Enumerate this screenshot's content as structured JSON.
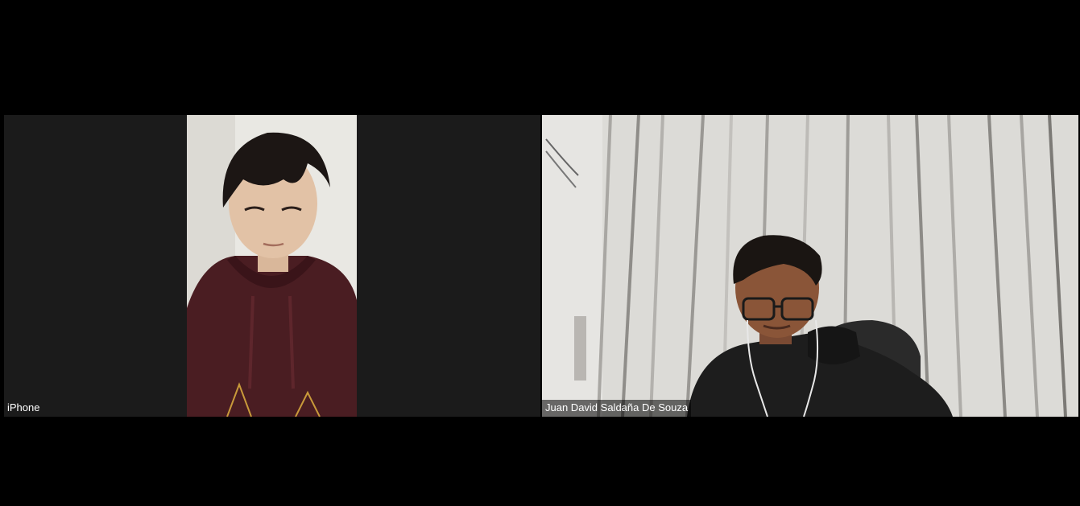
{
  "meeting": {
    "background_color": "#000000",
    "tile_color": "#1b1b1b"
  },
  "participants": [
    {
      "name": "iPhone",
      "video_on": true,
      "video_scene": "person in maroon hoodie against white wall (portrait phone video)"
    },
    {
      "name": "Juan David Saldaña De Souza",
      "video_on": true,
      "video_scene": "person with glasses and earphones in black hoodie in front of white curtains"
    }
  ]
}
